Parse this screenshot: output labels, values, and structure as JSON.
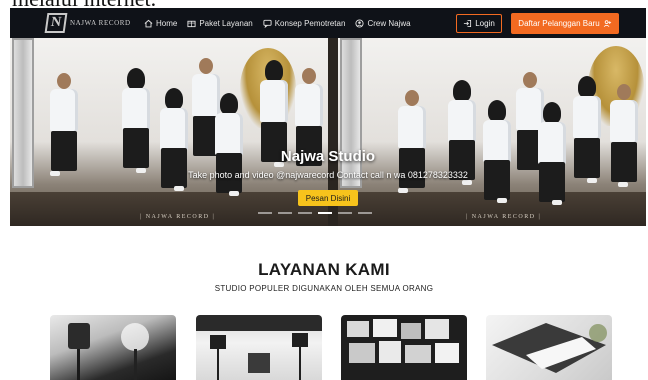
{
  "top_caption": "melalui internet.",
  "brand": {
    "logo_letter": "N",
    "name": "NAJWA RECORD"
  },
  "nav": {
    "items": [
      {
        "label": "Home",
        "icon": "home-icon"
      },
      {
        "label": "Paket Layanan",
        "icon": "package-icon"
      },
      {
        "label": "Konsep Pemotretan",
        "icon": "chat-icon"
      },
      {
        "label": "Crew Najwa",
        "icon": "user-icon"
      }
    ],
    "login_label": "Login",
    "register_label": "Daftar Pelanggan Baru"
  },
  "hero": {
    "title": "Najwa Studio",
    "subtitle": "Take photo and video @najwarecord Contact call n wa 081278323332",
    "button_label": "Pesan Disini",
    "watermark": "| NAJWA RECORD |",
    "slides_total": 6,
    "active_slide": 4
  },
  "services": {
    "title": "LAYANAN KAMI",
    "subtitle": "STUDIO POPULER DIGUNAKAN OLEH SEMUA ORANG"
  },
  "colors": {
    "accent": "#f26a21",
    "hero_button": "#f7c31c",
    "navbar": "#0f1218"
  }
}
